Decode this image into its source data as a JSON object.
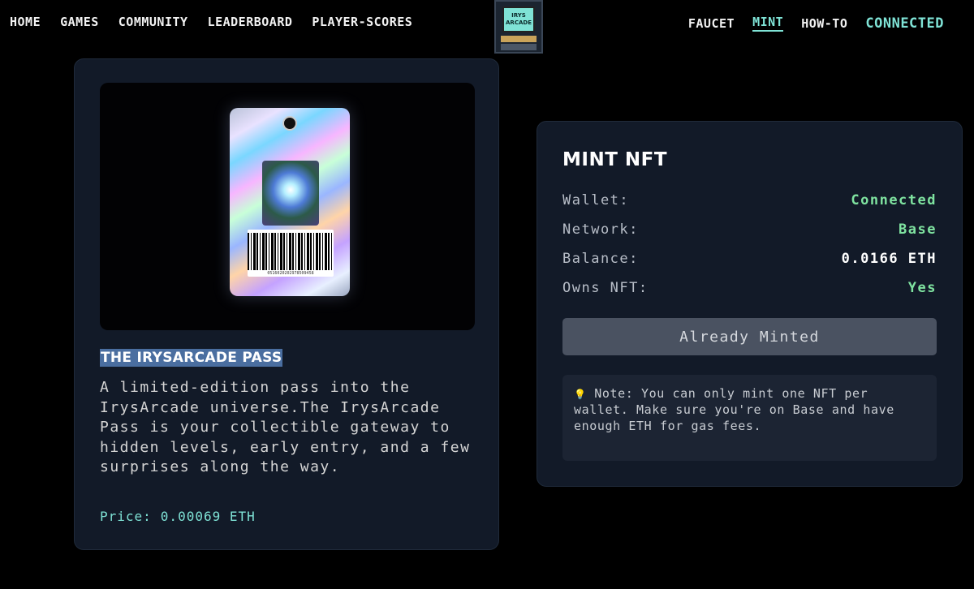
{
  "nav": {
    "left": [
      "HOME",
      "GAMES",
      "COMMUNITY",
      "LEADERBOARD",
      "PLAYER-SCORES"
    ],
    "right": [
      "FAUCET",
      "MINT",
      "HOW-TO"
    ],
    "connected": "CONNECTED",
    "logo_line1": "IRYS",
    "logo_line2": "ARCADE"
  },
  "pass": {
    "title": "THE IRYSARCADE PASS",
    "description": "A limited-edition pass into the IrysArcade universe.The IrysArcade Pass is your collectible gateway to hidden levels, early entry, and a few surprises along the way.",
    "price_label": "Price:",
    "price_value": "0.00069 ETH",
    "barcode_number": "0516020202978509458"
  },
  "mint": {
    "title": "MINT NFT",
    "rows": [
      {
        "label": "Wallet:",
        "value": "Connected"
      },
      {
        "label": "Network:",
        "value": "Base"
      },
      {
        "label": "Balance:",
        "value": "0.0166 ETH"
      },
      {
        "label": "Owns NFT:",
        "value": "Yes"
      }
    ],
    "button_label": "Already Minted",
    "note_icon": "💡",
    "note": "Note: You can only mint one NFT per wallet. Make sure you're on Base and have enough ETH for gas fees."
  },
  "colors": {
    "accent": "#7fe3d6",
    "green": "#7fe3a0",
    "card_bg": "#121a28",
    "page_bg": "#000000",
    "title_highlight": "#4a6ea0"
  }
}
